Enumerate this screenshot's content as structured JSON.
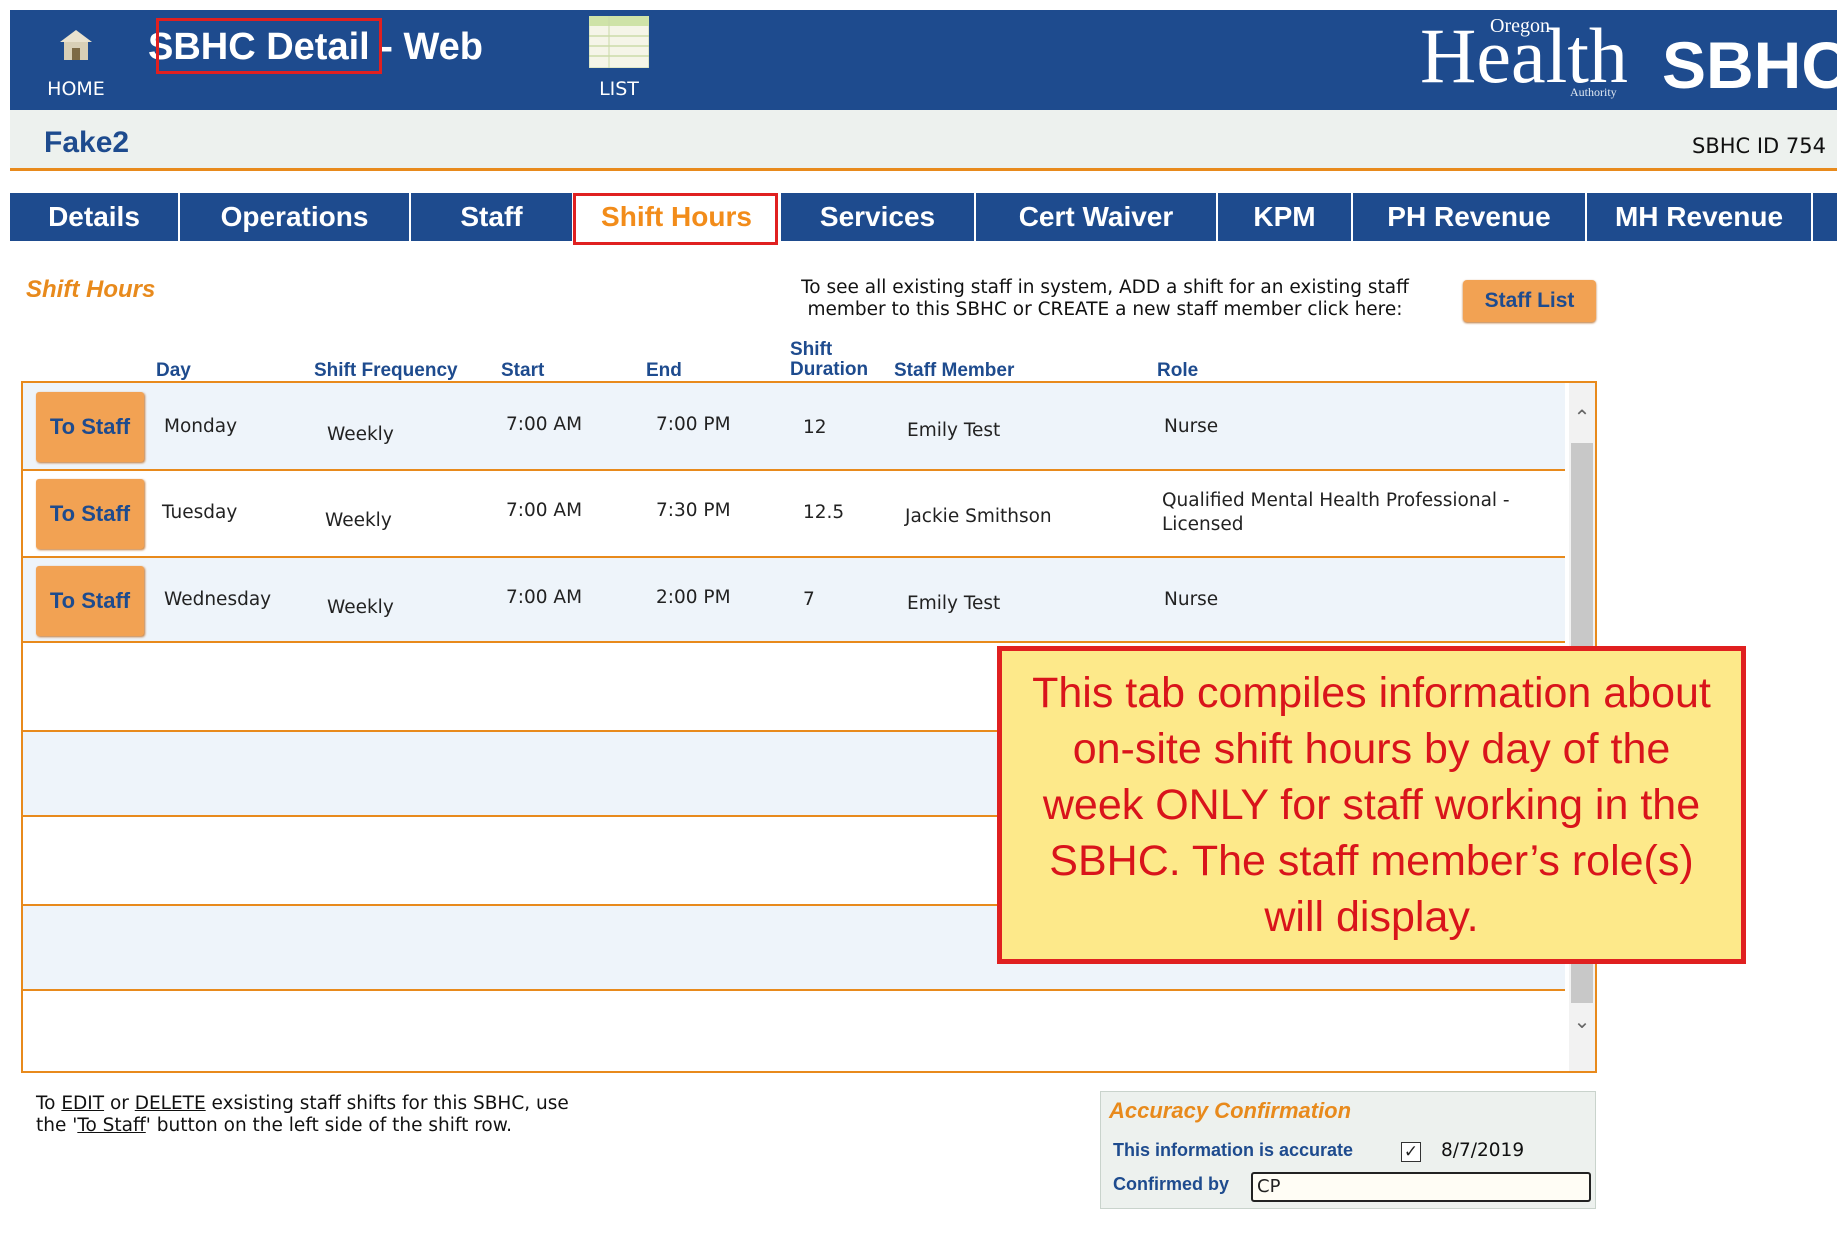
{
  "header": {
    "home_label": "HOME",
    "title_highlighted": "SBHC Detail",
    "title_suffix": " - Web",
    "list_label": "LIST",
    "logo_oregon": "Oregon",
    "logo_health": "Health",
    "logo_authority": "Authority",
    "logo_sbhc": "SBHC",
    "colors": {
      "banner": "#1e4b8e",
      "accent": "#e88a1c",
      "highlight_border": "#e02020"
    }
  },
  "clinic": {
    "name": "Fake2",
    "id_text": "SBHC ID 754"
  },
  "tabs": [
    {
      "label": "Details",
      "active": false
    },
    {
      "label": "Operations",
      "active": false
    },
    {
      "label": "Staff",
      "active": false
    },
    {
      "label": "Shift Hours",
      "active": true
    },
    {
      "label": "Services",
      "active": false
    },
    {
      "label": "Cert Waiver",
      "active": false
    },
    {
      "label": "KPM",
      "active": false
    },
    {
      "label": "PH Revenue",
      "active": false
    },
    {
      "label": "MH Revenue",
      "active": false
    }
  ],
  "section": {
    "title": "Shift Hours",
    "instruction_line1": "To see all existing staff in system, ADD a shift for an existing staff",
    "instruction_line2": "member to this SBHC or CREATE a new staff member click here:",
    "staff_list_button": "Staff List"
  },
  "table": {
    "headers": {
      "day": "Day",
      "frequency": "Shift Frequency",
      "start": "Start",
      "end": "End",
      "duration_line1": "Shift",
      "duration_line2": "Duration",
      "staff": "Staff Member",
      "role": "Role"
    },
    "row_button_label": "To Staff",
    "rows": [
      {
        "day": "Monday",
        "frequency": "Weekly",
        "start": "7:00 AM",
        "end": "7:00 PM",
        "duration": "12",
        "staff": "Emily Test",
        "role_line1": "Nurse",
        "role_line2": ""
      },
      {
        "day": "Tuesday",
        "frequency": "Weekly",
        "start": "7:00 AM",
        "end": "7:30 PM",
        "duration": "12.5",
        "staff": "Jackie Smithson",
        "role_line1": "Qualified Mental Health Professional -",
        "role_line2": "Licensed"
      },
      {
        "day": "Wednesday",
        "frequency": "Weekly",
        "start": "7:00 AM",
        "end": "2:00 PM",
        "duration": "7",
        "staff": "Emily Test",
        "role_line1": "Nurse",
        "role_line2": ""
      }
    ]
  },
  "footnote": {
    "line1_a": "To ",
    "edit": "EDIT",
    "line1_b": " or ",
    "delete": "DELETE",
    "line1_c": " exsisting staff shifts for this SBHC, use",
    "line2_a": "the '",
    "to_staff": "To Staff",
    "line2_b": "' button on the left side of the shift row."
  },
  "accuracy": {
    "title": "Accuracy Confirmation",
    "accurate_label": "This information is accurate",
    "checked": true,
    "date": "8/7/2019",
    "confirmed_by_label": "Confirmed by",
    "confirmed_by_value": "CP"
  },
  "callout": {
    "text": "This tab compiles information about on-site shift hours by day of the week ONLY for staff working in the SBHC. The staff member’s role(s) will display."
  }
}
